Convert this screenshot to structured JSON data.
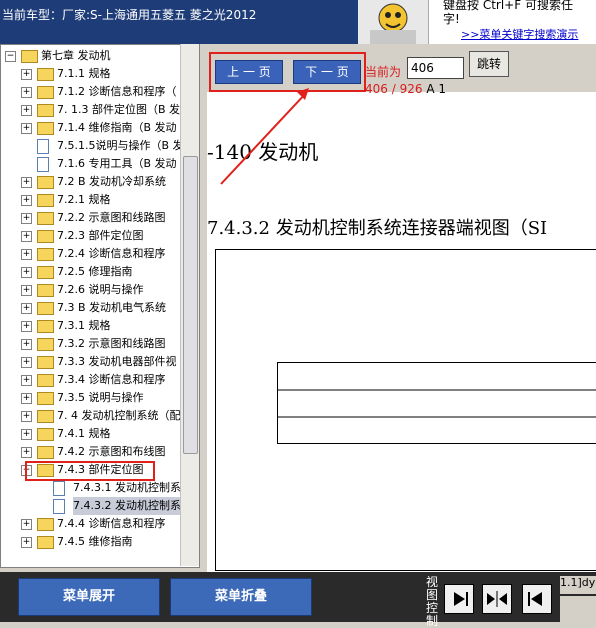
{
  "header": {
    "title": "当前车型：厂家:S-上海通用五菱五  菱之光2012"
  },
  "help": {
    "line1": "键盘按   Ctrl+F   可搜索任",
    "line2": "字!",
    "link": ">>菜单关键字搜索演示"
  },
  "tree": {
    "items": [
      {
        "label": "第七章 发动机",
        "type": "folder",
        "expander": "−"
      },
      {
        "label": "7.1.1 规格",
        "type": "folder",
        "expander": "+"
      },
      {
        "label": "7.1.2 诊断信息和程序（",
        "type": "folder",
        "expander": "+"
      },
      {
        "label": "7. 1.3 部件定位图（B 发",
        "type": "folder",
        "expander": "+"
      },
      {
        "label": "7.1.4 维修指南（B 发动",
        "type": "folder",
        "expander": "+"
      },
      {
        "label": "7.5.1.5说明与操作（B 发",
        "type": "doc",
        "expander": ""
      },
      {
        "label": "7.1.6 专用工具（B 发动",
        "type": "doc",
        "expander": ""
      },
      {
        "label": "7.2 B 发动机冷却系统",
        "type": "folder",
        "expander": "+"
      },
      {
        "label": "7.2.1 规格",
        "type": "folder",
        "expander": "+"
      },
      {
        "label": "7.2.2 示意图和线路图",
        "type": "folder",
        "expander": "+"
      },
      {
        "label": "7.2.3 部件定位图",
        "type": "folder",
        "expander": "+"
      },
      {
        "label": "7.2.4 诊断信息和程序",
        "type": "folder",
        "expander": "+"
      },
      {
        "label": "7.2.5 修理指南",
        "type": "folder",
        "expander": "+"
      },
      {
        "label": "7.2.6 说明与操作",
        "type": "folder",
        "expander": "+"
      },
      {
        "label": "7.3 B 发动机电气系统",
        "type": "folder",
        "expander": "+"
      },
      {
        "label": "7.3.1 规格",
        "type": "folder",
        "expander": "+"
      },
      {
        "label": "7.3.2 示意图和线路图",
        "type": "folder",
        "expander": "+"
      },
      {
        "label": "7.3.3 发动机电器部件视",
        "type": "folder",
        "expander": "+"
      },
      {
        "label": "7.3.4 诊断信息和程序",
        "type": "folder",
        "expander": "+"
      },
      {
        "label": "7.3.5 说明与操作",
        "type": "folder",
        "expander": "+"
      },
      {
        "label": "7. 4 发动机控制系统（配",
        "type": "folder",
        "expander": "+"
      },
      {
        "label": "7.4.1 规格",
        "type": "folder",
        "expander": "+"
      },
      {
        "label": "7.4.2 示意图和布线图",
        "type": "folder",
        "expander": "+"
      },
      {
        "label": "7.4.3 部件定位图",
        "type": "folder",
        "expander": "−"
      },
      {
        "label": "7.4.3.1 发动机控制系",
        "type": "doc",
        "expander": ""
      },
      {
        "label": "7.4.3.2 发动机控制系",
        "type": "doc",
        "expander": ""
      },
      {
        "label": "7.4.4 诊断信息和程序",
        "type": "folder",
        "expander": "+"
      },
      {
        "label": "7.4.5 维修指南",
        "type": "folder",
        "expander": "+"
      }
    ]
  },
  "nav": {
    "prev_label": "上 一 页",
    "next_label": "下 一 页",
    "current_label": "当前为",
    "page_value": "406",
    "jump_label": "跳转",
    "page_count": "406 / 926",
    "page_suffix": "A 1"
  },
  "doc": {
    "heading1": "-140   发动机",
    "heading2": "7.4.3.2 发动机控制系统连接器端视图（SI"
  },
  "bottom": {
    "expand_label": "菜单展开",
    "collapse_label": "菜单折叠",
    "view_label": "视图控制",
    "status": "1.1]dy"
  },
  "colors": {
    "highlight_box": "#e0201a",
    "nav_button": "#3a62b8",
    "title_bar": "#1e3c78"
  }
}
